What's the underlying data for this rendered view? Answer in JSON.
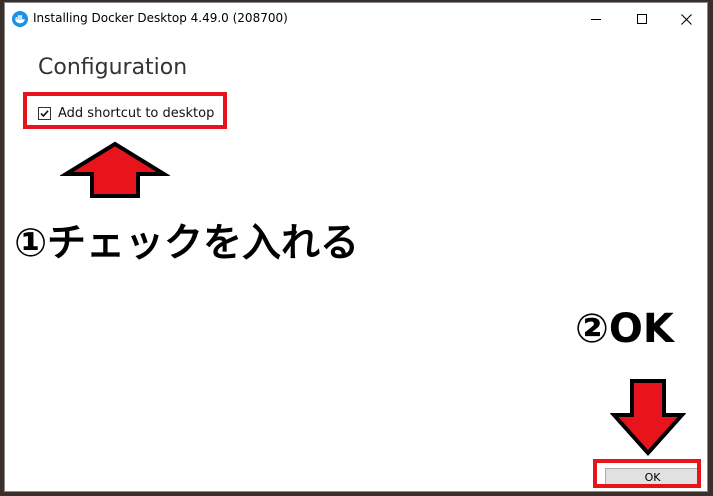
{
  "window": {
    "title": "Installing Docker Desktop 4.49.0 (208700)",
    "app_icon": "docker-whale-icon",
    "controls": [
      "minimize-icon",
      "maximize-icon",
      "close-icon"
    ]
  },
  "content": {
    "heading": "Configuration",
    "checkbox": {
      "label": "Add shortcut to desktop",
      "checked": true
    },
    "ok_label": "OK"
  },
  "annotations": {
    "step1": "①チェックを入れる",
    "step2": "②OK",
    "highlight_color": "#e8141c"
  }
}
